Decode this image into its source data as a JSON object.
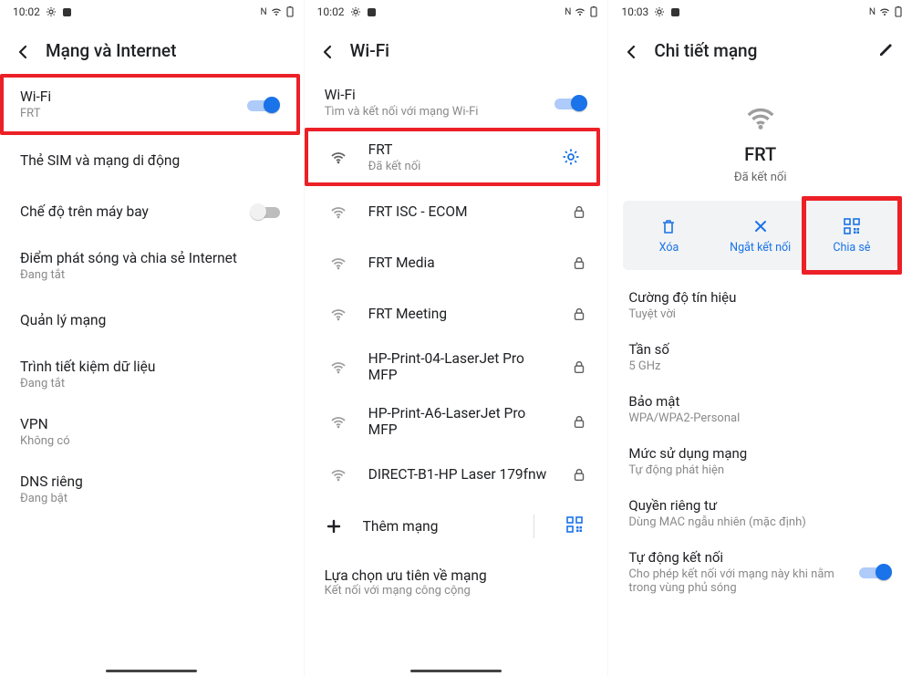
{
  "status": {
    "time1": "10:02",
    "time2": "10:02",
    "time3": "10:03",
    "ind_n": "N"
  },
  "pane1": {
    "title": "Mạng và Internet",
    "wifi": {
      "label": "Wi-Fi",
      "sub": "FRT"
    },
    "items1": [
      {
        "title": "Thẻ SIM và mạng di động"
      }
    ],
    "airplane": {
      "title": "Chế độ trên máy bay"
    },
    "hotspot": {
      "title": "Điểm phát sóng và chia sẻ Internet",
      "sub": "Đang tắt"
    },
    "items2": [
      {
        "title": "Quản lý mạng"
      },
      {
        "title": "Trình tiết kiệm dữ liệu",
        "sub": "Đang tắt"
      },
      {
        "title": "VPN",
        "sub": "Không có"
      },
      {
        "title": "DNS riêng",
        "sub": "Đang bật"
      }
    ]
  },
  "pane2": {
    "title": "Wi-Fi",
    "wifi_toggle": {
      "label": "Wi-Fi",
      "sub": "Tìm và kết nối với mạng Wi-Fi"
    },
    "connected": {
      "name": "FRT",
      "status": "Đã kết nối"
    },
    "networks": [
      {
        "name": "FRT ISC - ECOM"
      },
      {
        "name": "FRT Media"
      },
      {
        "name": "FRT Meeting"
      },
      {
        "name": "HP-Print-04-LaserJet Pro MFP"
      },
      {
        "name": "HP-Print-A6-LaserJet Pro MFP"
      },
      {
        "name": "DIRECT-B1-HP Laser 179fnw"
      }
    ],
    "add": "Thêm mạng",
    "pref_title": "Lựa chọn ưu tiên về mạng",
    "pref_sub": "Kết nối với mạng công cộng"
  },
  "pane3": {
    "title": "Chi tiết mạng",
    "net_name": "FRT",
    "net_status": "Đã kết nối",
    "actions": {
      "delete": "Xóa",
      "disconnect": "Ngắt kết nối",
      "share": "Chia sẻ"
    },
    "sections": [
      {
        "title": "Cường độ tín hiệu",
        "sub": "Tuyệt vời"
      },
      {
        "title": "Tần số",
        "sub": "5 GHz"
      },
      {
        "title": "Bảo mật",
        "sub": "WPA/WPA2-Personal"
      },
      {
        "title": "Mức sử dụng mạng",
        "sub": "Tự động phát hiện"
      },
      {
        "title": "Quyền riêng tư",
        "sub": "Dùng MAC ngẫu nhiên (mặc định)"
      }
    ],
    "auto_connect": {
      "title": "Tự động kết nối",
      "sub": "Cho phép kết nối với mạng này khi nằm trong vùng phủ sóng"
    }
  }
}
